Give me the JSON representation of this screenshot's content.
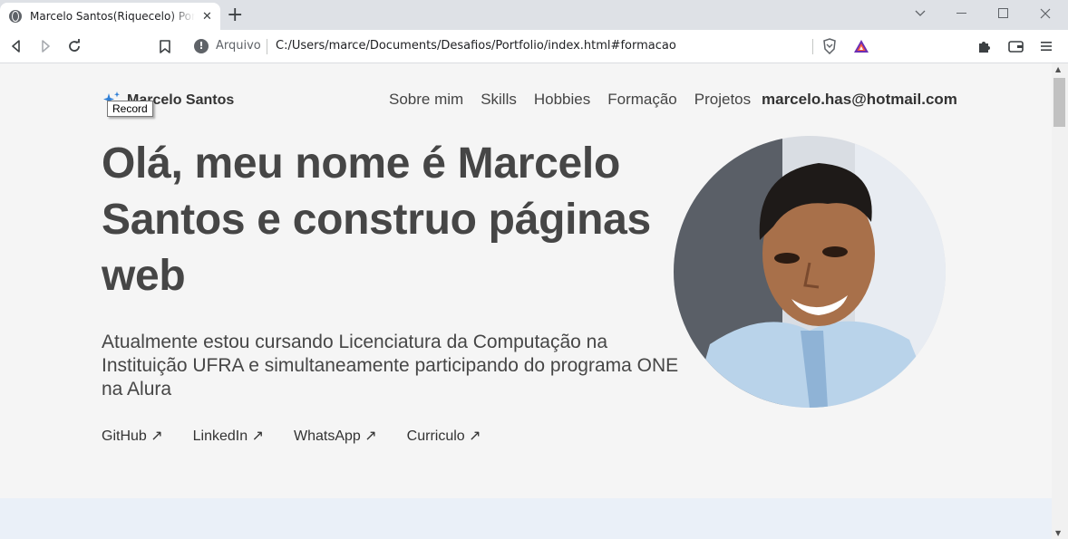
{
  "browser": {
    "tab_title": "Marcelo Santos(Riquecelo) Portfolio",
    "address_label": "Arquivo",
    "url": "C:/Users/marce/Documents/Desafios/Portfolio/index.html#formacao"
  },
  "header": {
    "brand_name": "Marcelo Santos",
    "tooltip": "Record",
    "nav": [
      {
        "label": "Sobre mim"
      },
      {
        "label": "Skills"
      },
      {
        "label": "Hobbies"
      },
      {
        "label": "Formação"
      },
      {
        "label": "Projetos"
      }
    ],
    "email": "marcelo.has@hotmail.com"
  },
  "hero": {
    "title": "Olá, meu nome é Marcelo Santos e construo páginas web",
    "description": "Atualmente estou cursando Licenciatura da Computação na Instituição UFRA e simultaneamente participando do programa ONE na Alura",
    "links": [
      {
        "label": "GitHub ↗"
      },
      {
        "label": "LinkedIn ↗"
      },
      {
        "label": "WhatsApp ↗"
      },
      {
        "label": "Curriculo ↗"
      }
    ]
  },
  "icons": {
    "brand": "sparkle-icon",
    "back": "back-arrow-icon",
    "forward": "forward-arrow-icon",
    "reload": "reload-icon",
    "bookmark": "bookmark-icon",
    "info": "info-icon",
    "brave": "brave-shield-icon",
    "rewards": "brave-rewards-icon",
    "extensions": "puzzle-icon",
    "wallet": "wallet-icon",
    "menu": "menu-icon"
  },
  "colors": {
    "page_bg": "#f5f5f5",
    "heading": "#464646",
    "section_band": "#eaf0f8"
  }
}
